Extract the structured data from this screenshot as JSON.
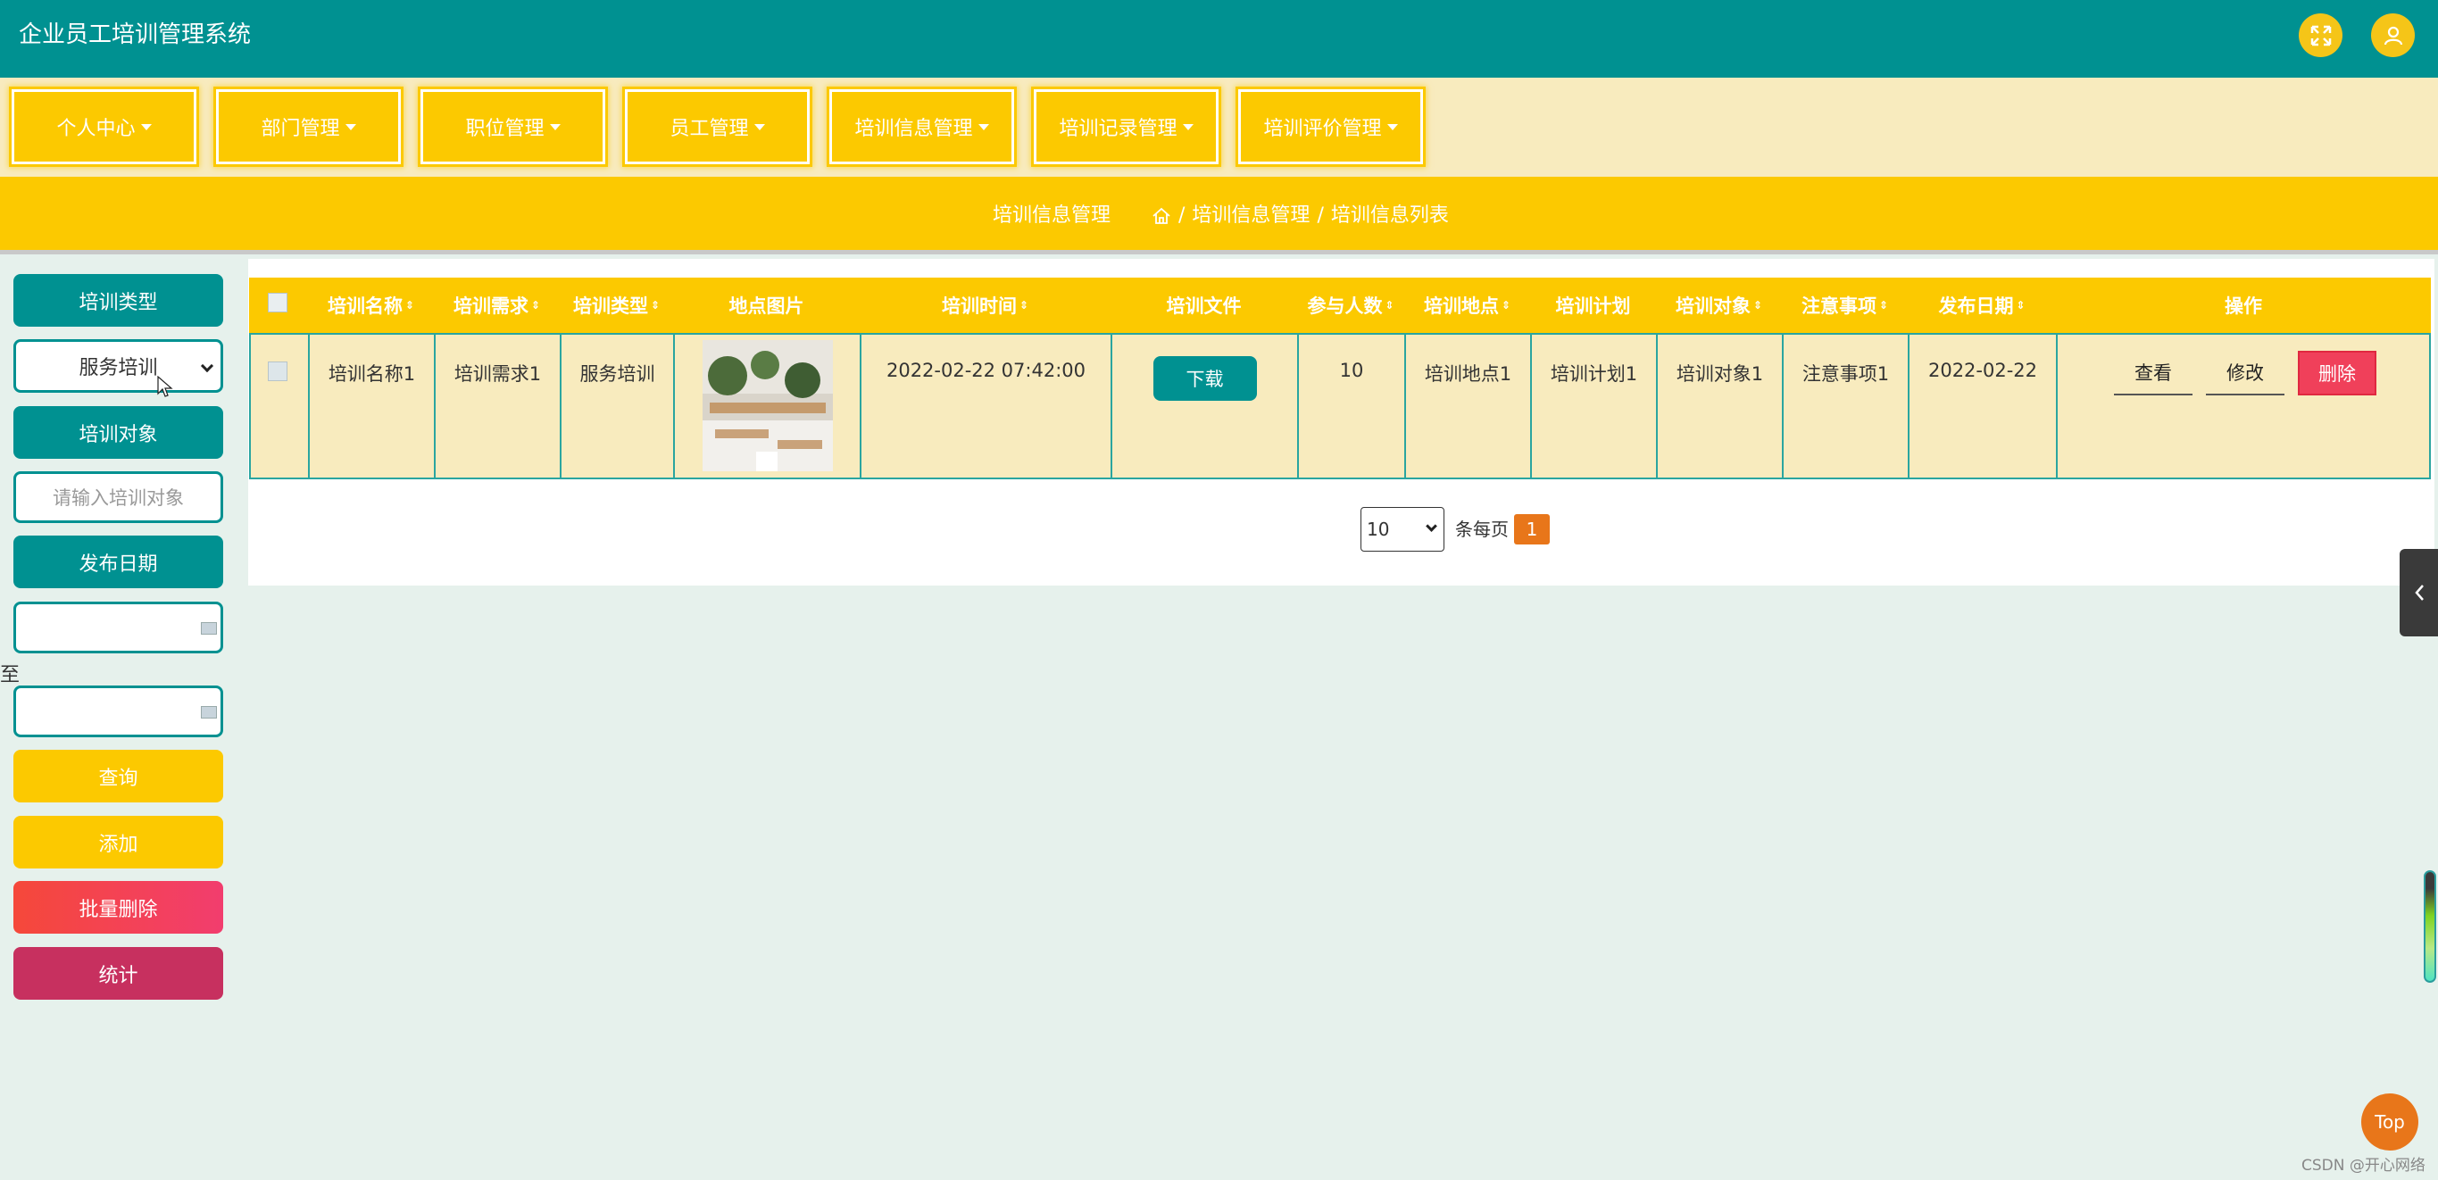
{
  "header": {
    "app_title": "企业员工培训管理系统"
  },
  "menu": {
    "items": [
      {
        "label": "个人中心"
      },
      {
        "label": "部门管理"
      },
      {
        "label": "职位管理"
      },
      {
        "label": "员工管理"
      },
      {
        "label": "培训信息管理"
      },
      {
        "label": "培训记录管理"
      },
      {
        "label": "培训评价管理"
      }
    ]
  },
  "breadcrumb": {
    "title": "培训信息管理",
    "path": [
      "培训信息管理",
      "培训信息列表"
    ],
    "separator": "/"
  },
  "filters": {
    "type_label": "培训类型",
    "type_value": "服务培训",
    "target_label": "培训对象",
    "target_placeholder": "请输入培训对象",
    "date_label": "发布日期",
    "date_to": "至",
    "search_button": "查询",
    "add_button": "添加",
    "batch_delete_button": "批量删除",
    "stats_button": "统计"
  },
  "table": {
    "columns": [
      "培训名称",
      "培训需求",
      "培训类型",
      "地点图片",
      "培训时间",
      "培训文件",
      "参与人数",
      "培训地点",
      "培训计划",
      "培训对象",
      "注意事项",
      "发布日期",
      "操作"
    ],
    "rows": [
      {
        "name": "培训名称1",
        "need": "培训需求1",
        "type": "服务培训",
        "time": "2022-02-22 07:42:00",
        "file_button": "下载",
        "count": "10",
        "location": "培训地点1",
        "plan": "培训计划1",
        "target": "培训对象1",
        "notes": "注意事项1",
        "date": "2022-02-22",
        "actions": {
          "view": "查看",
          "edit": "修改",
          "delete": "删除"
        }
      }
    ]
  },
  "pagination": {
    "page_size": "10",
    "per_page_label": "条每页",
    "current_page": "1"
  },
  "widgets": {
    "top_button": "Top",
    "watermark": "CSDN @开心网络"
  },
  "colors": {
    "teal": "#009191",
    "gold": "#fcc900",
    "cream": "#f8ebbe",
    "orange": "#e8761a",
    "delete_red": "#f0405a",
    "stats_magenta": "#c7305f"
  }
}
